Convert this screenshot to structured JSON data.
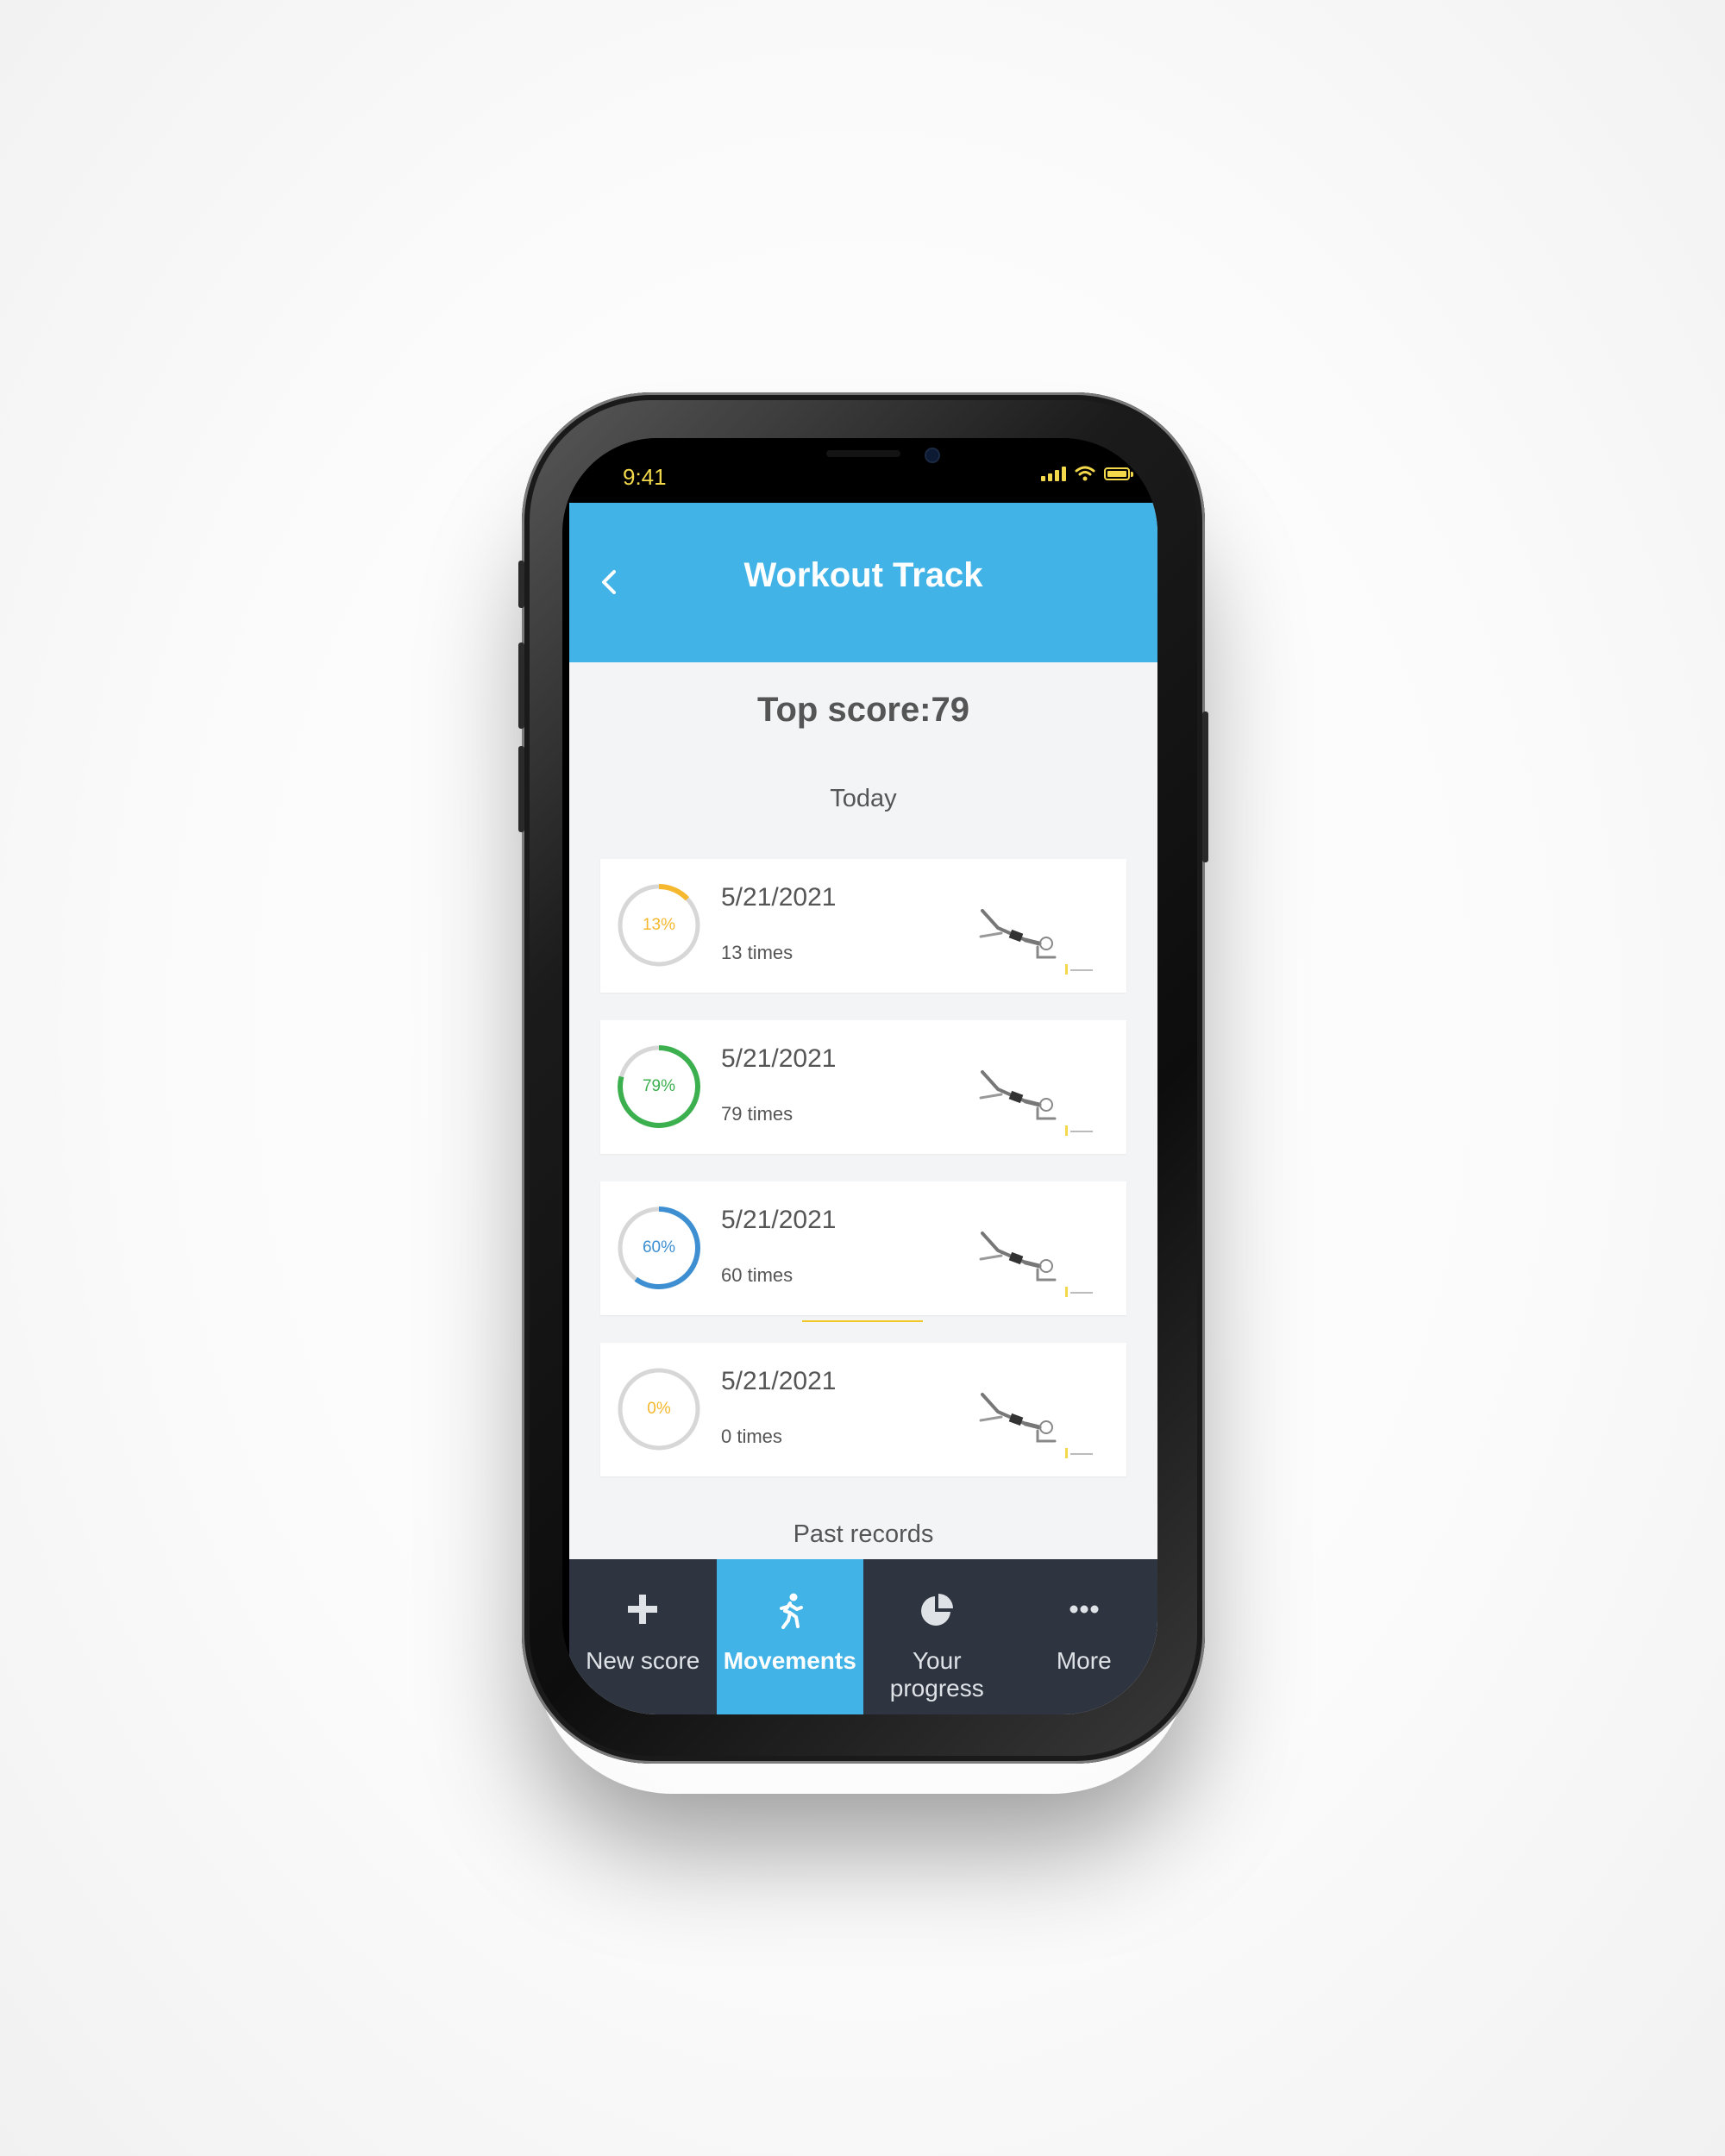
{
  "status_bar": {
    "time": "9:41",
    "color": "#f2d84a"
  },
  "header": {
    "title": "Workout Track",
    "back_icon": "chevron-left-icon",
    "color": "#41b3e6"
  },
  "top_score": "Top score:79",
  "sections": {
    "today": "Today",
    "past_records": "Past records"
  },
  "records": [
    {
      "percent_label": "13%",
      "percent": 0.13,
      "date": "5/21/2021",
      "count": "13 times",
      "ring_color": "#f5b82e"
    },
    {
      "percent_label": "79%",
      "percent": 0.79,
      "date": "5/21/2021",
      "count": "79 times",
      "ring_color": "#3cb04e"
    },
    {
      "percent_label": "60%",
      "percent": 0.6,
      "date": "5/21/2021",
      "count": "60 times",
      "ring_color": "#3d8fd1"
    },
    {
      "percent_label": "0%",
      "percent": 0.0,
      "date": "5/21/2021",
      "count": "0 times",
      "ring_color": "#f5b82e"
    }
  ],
  "tabs": [
    {
      "label": "New score",
      "icon": "plus-icon",
      "active": false
    },
    {
      "label": "Movements",
      "icon": "running-person-icon",
      "active": true
    },
    {
      "label": "Your progress",
      "icon": "pie-chart-icon",
      "active": false
    },
    {
      "label": "More",
      "icon": "more-dots-icon",
      "active": false
    }
  ],
  "colors": {
    "tab_bar": "#2f3540",
    "active_tab": "#41b3e6",
    "background": "#f3f4f6"
  }
}
